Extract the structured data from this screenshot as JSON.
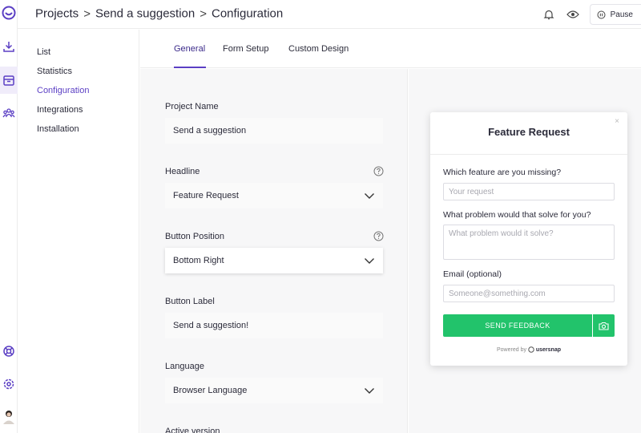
{
  "breadcrumb": {
    "projects": "Projects",
    "project": "Send a suggestion",
    "page": "Configuration",
    "separator": ">"
  },
  "top_actions": {
    "notifications_icon": "bell-icon",
    "preview_icon": "eye-icon",
    "pause_label": "Pause"
  },
  "rail": {
    "icons": [
      "logo-icon",
      "download-icon",
      "inbox-icon",
      "team-icon",
      "help-lifebuoy-icon",
      "settings-icon",
      "user-avatar"
    ]
  },
  "subnav": {
    "items": [
      {
        "label": "List"
      },
      {
        "label": "Statistics"
      },
      {
        "label": "Configuration",
        "active": true
      },
      {
        "label": "Integrations"
      },
      {
        "label": "Installation"
      }
    ]
  },
  "tabs": [
    {
      "label": "General",
      "active": true
    },
    {
      "label": "Form Setup"
    },
    {
      "label": "Custom Design"
    }
  ],
  "form": {
    "project_name_label": "Project Name",
    "project_name_value": "Send a suggestion",
    "headline_label": "Headline",
    "headline_value": "Feature Request",
    "button_position_label": "Button Position",
    "button_position_value": "Bottom Right",
    "button_label_label": "Button Label",
    "button_label_value": "Send a suggestion!",
    "language_label": "Language",
    "language_value": "Browser Language",
    "next_section_label": "Active version"
  },
  "widget": {
    "title": "Feature Request",
    "close": "×",
    "q1_label": "Which feature are you missing?",
    "q1_placeholder": "Your request",
    "q2_label": "What problem would that solve for you?",
    "q2_placeholder": "What problem would it solve?",
    "email_label": "Email (optional)",
    "email_placeholder": "Someone@something.com",
    "send_label": "SEND FEEDBACK",
    "powered_prefix": "Powered by",
    "powered_brand": "usersnap"
  },
  "colors": {
    "accent": "#5b3fc4",
    "send_button": "#22c36b",
    "panel_bg": "#f7f7f8"
  }
}
